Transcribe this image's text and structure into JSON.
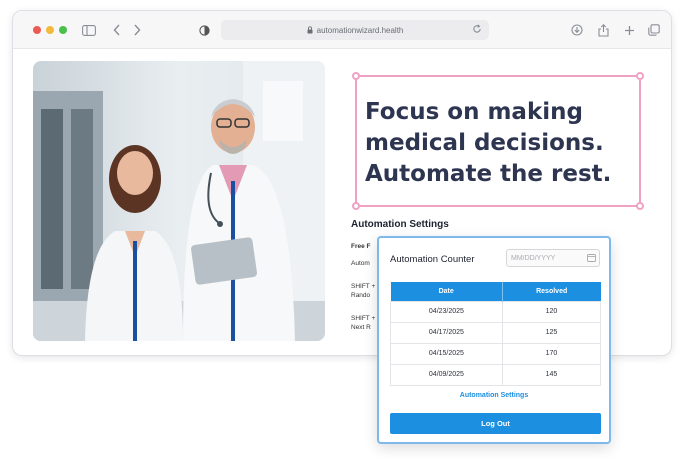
{
  "browser": {
    "url": "automationwizard.health",
    "icons": [
      "sidebar-icon",
      "back-icon",
      "forward-icon",
      "shield-icon",
      "lock-icon",
      "reload-icon",
      "download-icon",
      "share-icon",
      "new-tab-icon",
      "tabs-icon"
    ]
  },
  "hero": {
    "lines": [
      "Focus on making",
      "medical decisions.",
      "Automate the rest."
    ],
    "frame_color": "#f0a2c4"
  },
  "settings": {
    "title": "Automation Settings",
    "line1": "Free F",
    "line2": "Autom",
    "line3a": "SHIFT +",
    "line3b": "Rando",
    "line4a": "SHIFT +",
    "line4b": "Next R"
  },
  "panel": {
    "title": "Automation Counter",
    "date_placeholder": "MM/DD/YYYY",
    "columns": [
      "Date",
      "Resolved"
    ],
    "rows": [
      {
        "date": "04/23/2025",
        "resolved": "120"
      },
      {
        "date": "04/17/2025",
        "resolved": "125"
      },
      {
        "date": "04/15/2025",
        "resolved": "170"
      },
      {
        "date": "04/09/2025",
        "resolved": "145"
      }
    ],
    "settings_link": "Automation Settings",
    "logout_label": "Log Out",
    "accent_color": "#1c8fe0"
  }
}
